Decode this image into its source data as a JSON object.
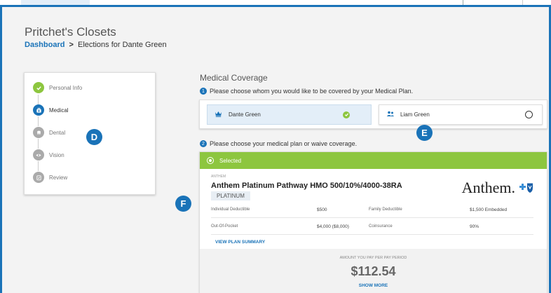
{
  "company": "Pritchet's Closets",
  "breadcrumb": {
    "root": "Dashboard",
    "separator": ">",
    "current": "Elections for Dante Green"
  },
  "steps": [
    {
      "label": "Personal Info",
      "state": "complete",
      "icon": "check-icon"
    },
    {
      "label": "Medical",
      "state": "active",
      "icon": "medical-bag-icon"
    },
    {
      "label": "Dental",
      "state": "pending",
      "icon": "tooth-icon"
    },
    {
      "label": "Vision",
      "state": "pending",
      "icon": "eye-icon"
    },
    {
      "label": "Review",
      "state": "pending",
      "icon": "review-icon"
    }
  ],
  "callouts": {
    "d": "D",
    "e": "E",
    "f": "F"
  },
  "coverage": {
    "title": "Medical Coverage",
    "q1_num": "1",
    "q1": "Please choose whom you would like to be covered by your Medical Plan.",
    "members": [
      {
        "name": "Dante Green",
        "selected": true,
        "icon": "crown-icon"
      },
      {
        "name": "Liam Green",
        "selected": false,
        "icon": "people-icon"
      }
    ],
    "q2_num": "2",
    "q2": "Please choose your medical plan or waive coverage."
  },
  "plan": {
    "status": "Selected",
    "carrier": "ANTHEM",
    "name": "Anthem Platinum Pathway HMO 500/10%/4000-38RA",
    "tier": "PLATINUM",
    "logo_text": "Anthem.",
    "rows": [
      {
        "l1": "Individual Deductible",
        "v1": "$500",
        "l2": "Family Deductible",
        "v2": "$1,500 Embedded"
      },
      {
        "l1": "Out-Of-Pocket",
        "v1": "$4,000 ($8,000)",
        "l2": "Coinsurance",
        "v2": "90%"
      }
    ],
    "view_summary": "VIEW PLAN SUMMARY",
    "pay_label": "AMOUNT YOU PAY PER PAY PERIOD",
    "pay_amount": "$112.54",
    "show_more": "SHOW MORE"
  },
  "colors": {
    "accent": "#1a73b8",
    "success": "#8dc63f",
    "pending": "#aaaaaa",
    "selected_bg": "#e3eef8"
  }
}
